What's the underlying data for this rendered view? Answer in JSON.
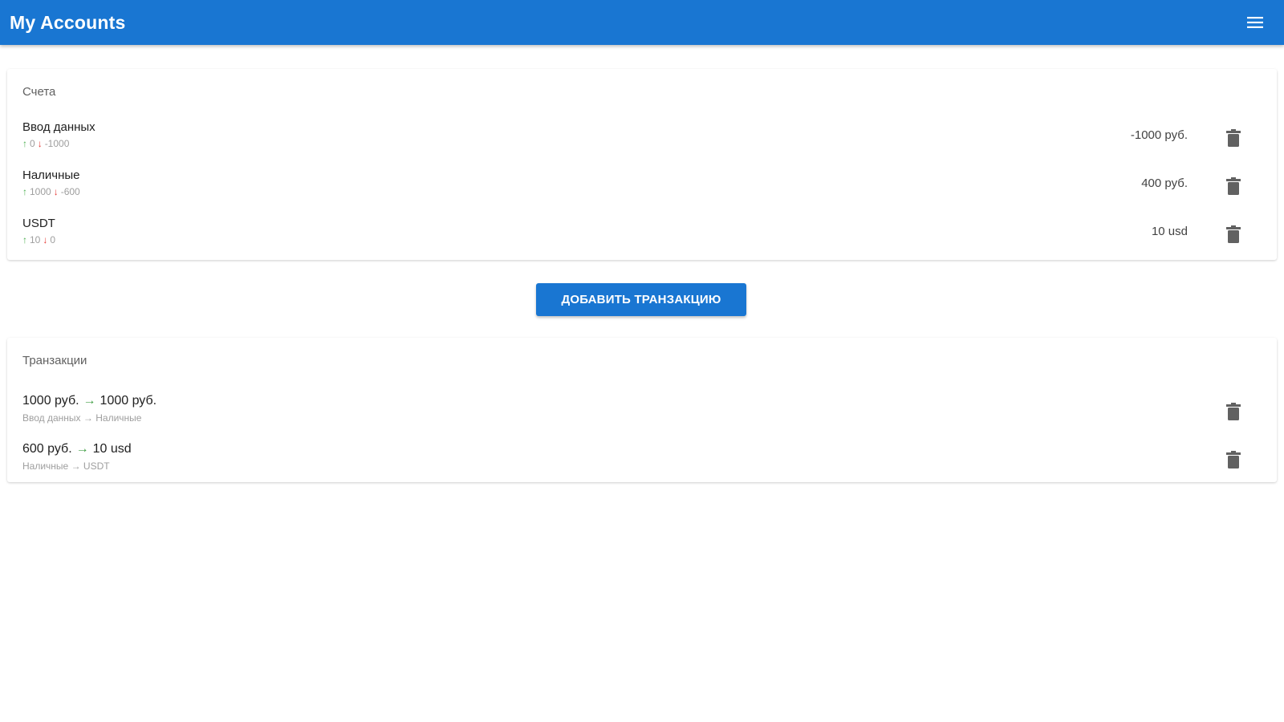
{
  "appbar": {
    "title": "My Accounts",
    "menu_icon": "menu-icon"
  },
  "accounts": {
    "title": "Счета",
    "items": [
      {
        "name": "Ввод данных",
        "income": "0",
        "expense": "-1000",
        "balance": "-1000 руб."
      },
      {
        "name": "Наличные",
        "income": "1000",
        "expense": "-600",
        "balance": "400 руб."
      },
      {
        "name": "USDT",
        "income": "10",
        "expense": "0",
        "balance": "10 usd"
      }
    ]
  },
  "actions": {
    "add_transaction_label": "ДОБАВИТЬ ТРАНЗАКЦИЮ"
  },
  "transactions": {
    "title": "Транзакции",
    "items": [
      {
        "from_amount": "1000 руб.",
        "to_amount": "1000 руб.",
        "from_account": "Ввод данных",
        "to_account": "Наличные"
      },
      {
        "from_amount": "600 руб.",
        "to_amount": "10 usd",
        "from_account": "Наличные",
        "to_account": "USDT"
      }
    ]
  },
  "colors": {
    "primary": "#1976d2",
    "income": "#4caf50",
    "expense": "#e53935",
    "icon": "#616161"
  }
}
